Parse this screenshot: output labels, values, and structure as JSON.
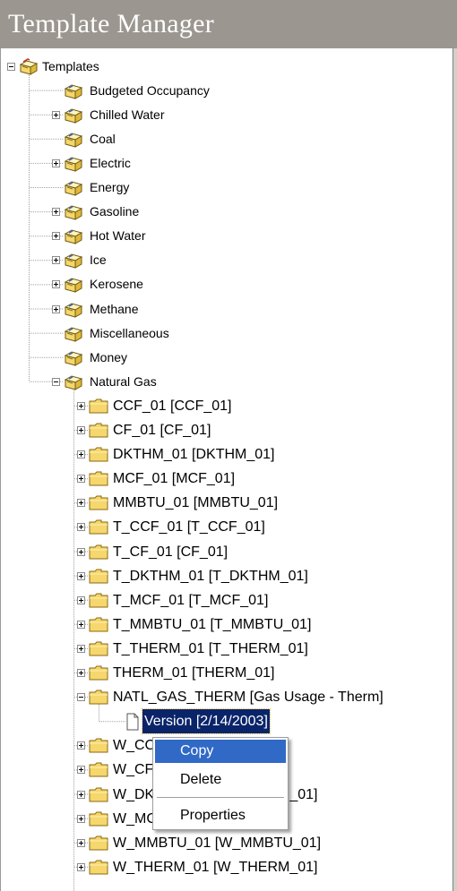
{
  "app": {
    "title": "Template Manager"
  },
  "tree": {
    "root_label": "Templates",
    "categories": [
      {
        "label": "Budgeted Occupancy",
        "expander": "none"
      },
      {
        "label": "Chilled Water",
        "expander": "plus"
      },
      {
        "label": "Coal",
        "expander": "none"
      },
      {
        "label": "Electric",
        "expander": "plus"
      },
      {
        "label": "Energy",
        "expander": "none"
      },
      {
        "label": "Gasoline",
        "expander": "plus"
      },
      {
        "label": "Hot Water",
        "expander": "plus"
      },
      {
        "label": "Ice",
        "expander": "plus"
      },
      {
        "label": "Kerosene",
        "expander": "plus"
      },
      {
        "label": "Methane",
        "expander": "plus"
      },
      {
        "label": "Miscellaneous",
        "expander": "none"
      },
      {
        "label": "Money",
        "expander": "none"
      },
      {
        "label": "Natural Gas",
        "expander": "minus"
      }
    ],
    "natural_gas_children": [
      {
        "label": "CCF_01 [CCF_01]",
        "expander": "plus"
      },
      {
        "label": "CF_01 [CF_01]",
        "expander": "plus"
      },
      {
        "label": "DKTHM_01 [DKTHM_01]",
        "expander": "plus"
      },
      {
        "label": "MCF_01 [MCF_01]",
        "expander": "plus"
      },
      {
        "label": "MMBTU_01 [MMBTU_01]",
        "expander": "plus"
      },
      {
        "label": "T_CCF_01 [T_CCF_01]",
        "expander": "plus"
      },
      {
        "label": "T_CF_01 [CF_01]",
        "expander": "plus"
      },
      {
        "label": "T_DKTHM_01 [T_DKTHM_01]",
        "expander": "plus"
      },
      {
        "label": "T_MCF_01 [T_MCF_01]",
        "expander": "plus"
      },
      {
        "label": "T_MMBTU_01 [T_MMBTU_01]",
        "expander": "plus"
      },
      {
        "label": "T_THERM_01 [T_THERM_01]",
        "expander": "plus"
      },
      {
        "label": "THERM_01 [THERM_01]",
        "expander": "plus"
      },
      {
        "label": "NATL_GAS_THERM [Gas Usage - Therm]",
        "expander": "minus"
      },
      {
        "label": "Version [2/14/2003]",
        "expander": "none",
        "selected": true,
        "doc": true
      },
      {
        "label": "W_CCF_01 [W_CCF_01]",
        "expander": "plus"
      },
      {
        "label": "W_CF_01 [W_CF_01]",
        "expander": "plus"
      },
      {
        "label": "W_DKTHM_01 [W_DKTHM_01]",
        "expander": "plus"
      },
      {
        "label": "W_MCF_01 [W_MCF_01]",
        "expander": "plus"
      },
      {
        "label": "W_MMBTU_01 [W_MMBTU_01]",
        "expander": "plus"
      },
      {
        "label": "W_THERM_01 [W_THERM_01]",
        "expander": "plus"
      }
    ]
  },
  "context_menu": {
    "items": [
      {
        "label": "Copy",
        "highlighted": true
      },
      {
        "label": "Delete",
        "highlighted": false
      },
      {
        "separator": true
      },
      {
        "label": "Properties",
        "highlighted": false
      }
    ]
  },
  "colors": {
    "title_bar_bg": "#9b968f",
    "selection_bg": "#0a246a",
    "menu_highlight": "#3169c6",
    "folder_yellow": "#f5d76e"
  },
  "icons": {
    "root": "open-template-book-icon",
    "category": "template-book-icon",
    "folder": "folder-icon",
    "version": "document-icon"
  }
}
